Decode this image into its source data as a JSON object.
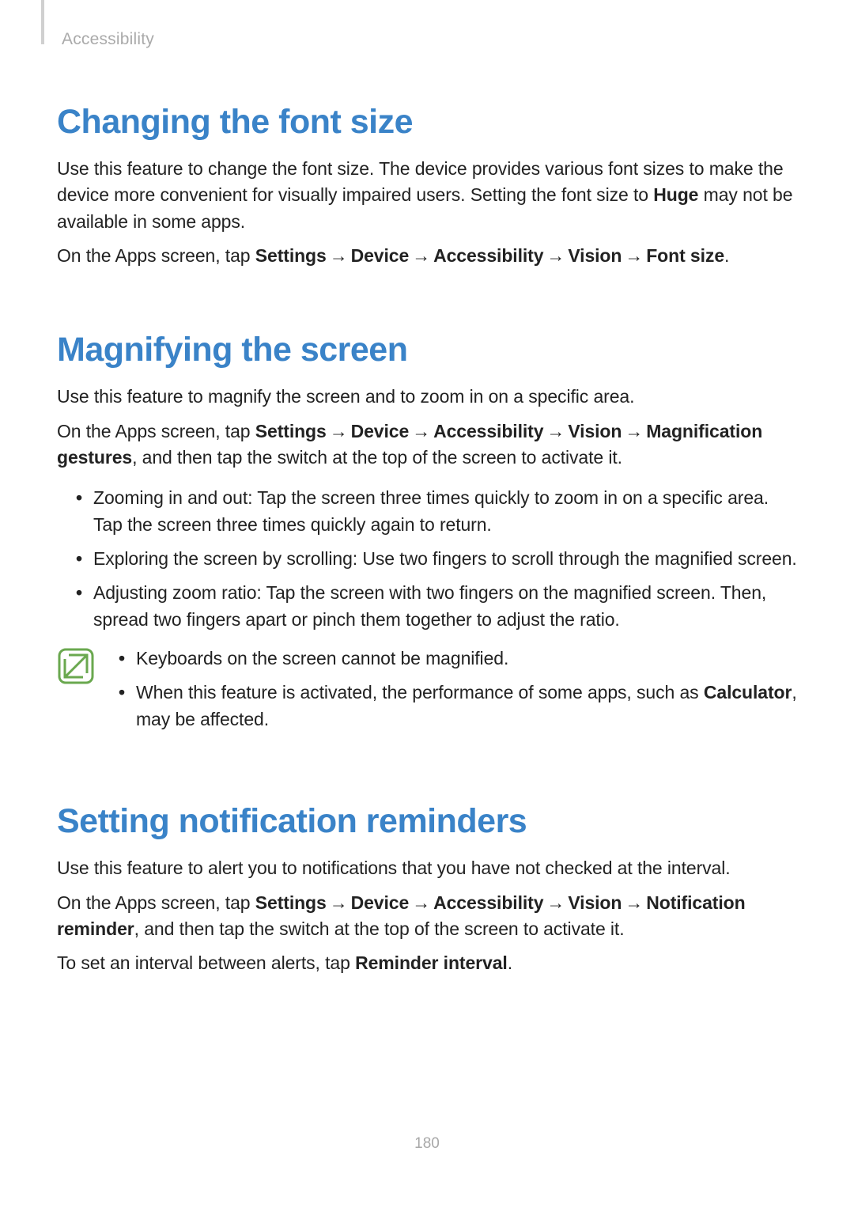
{
  "header": {
    "breadcrumb": "Accessibility"
  },
  "arrow": "→",
  "section1": {
    "heading": "Changing the font size",
    "p1_a": "Use this feature to change the font size. The device provides various font sizes to make the device more convenient for visually impaired users. Setting the font size to ",
    "p1_bold": "Huge",
    "p1_b": " may not be available in some apps.",
    "p2_a": "On the Apps screen, tap ",
    "p2_settings": "Settings",
    "p2_device": "Device",
    "p2_accessibility": "Accessibility",
    "p2_vision": "Vision",
    "p2_fontsize": "Font size",
    "p2_end": "."
  },
  "section2": {
    "heading": "Magnifying the screen",
    "p1": "Use this feature to magnify the screen and to zoom in on a specific area.",
    "p2_a": "On the Apps screen, tap ",
    "p2_settings": "Settings",
    "p2_device": "Device",
    "p2_accessibility": "Accessibility",
    "p2_vision": "Vision",
    "p2_mag": "Magnification gestures",
    "p2_b": ", and then tap the switch at the top of the screen to activate it.",
    "bullets": [
      "Zooming in and out: Tap the screen three times quickly to zoom in on a specific area. Tap the screen three times quickly again to return.",
      "Exploring the screen by scrolling: Use two fingers to scroll through the magnified screen.",
      "Adjusting zoom ratio: Tap the screen with two fingers on the magnified screen. Then, spread two fingers apart or pinch them together to adjust the ratio."
    ],
    "note_bullets_0": "Keyboards on the screen cannot be magnified.",
    "note_bullets_1a": "When this feature is activated, the performance of some apps, such as ",
    "note_bullets_1_bold": "Calculator",
    "note_bullets_1b": ", may be affected."
  },
  "section3": {
    "heading": "Setting notification reminders",
    "p1": "Use this feature to alert you to notifications that you have not checked at the interval.",
    "p2_a": "On the Apps screen, tap ",
    "p2_settings": "Settings",
    "p2_device": "Device",
    "p2_accessibility": "Accessibility",
    "p2_vision": "Vision",
    "p2_notif": "Notification reminder",
    "p2_b": ", and then tap the switch at the top of the screen to activate it.",
    "p3_a": "To set an interval between alerts, tap ",
    "p3_bold": "Reminder interval",
    "p3_b": "."
  },
  "page_number": "180"
}
